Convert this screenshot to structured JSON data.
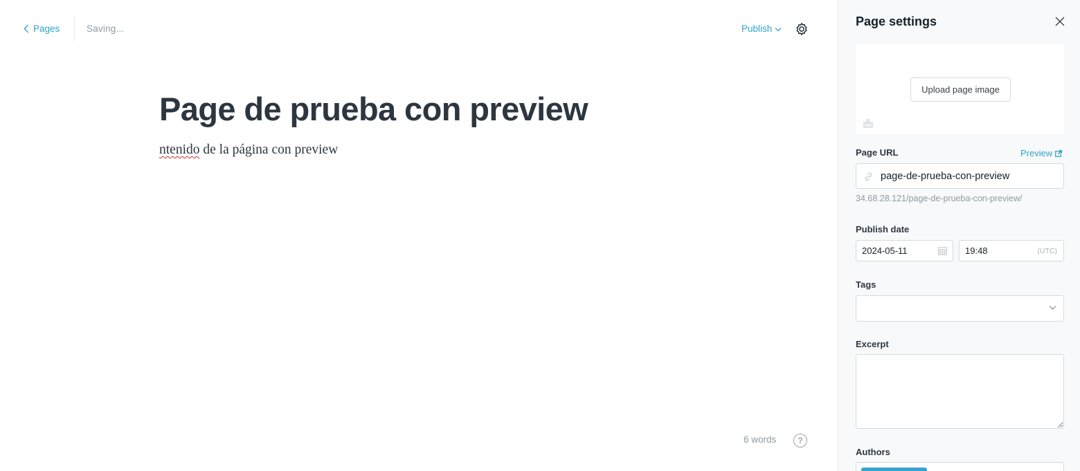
{
  "editor": {
    "back_label": "Pages",
    "status": "Saving...",
    "publish_label": "Publish",
    "title": "Page de prueba con preview",
    "body_misspelled": "ntenido",
    "body_rest": " de la página con preview",
    "word_count": "6 words",
    "help_glyph": "?"
  },
  "panel": {
    "title": "Page settings",
    "upload_label": "Upload page image",
    "url_label": "Page URL",
    "preview_label": "Preview",
    "url_value": "page-de-prueba-con-preview",
    "url_hint": "34.68.28.121/page-de-prueba-con-preview/",
    "publish_date_label": "Publish date",
    "date_value": "2024-05-11",
    "time_value": "19:48",
    "timezone": "(UTC)",
    "tags_label": "Tags",
    "excerpt_label": "Excerpt",
    "authors_label": "Authors"
  },
  "colors": {
    "accent": "#30a4c8",
    "panel_bg": "#f8f9fa",
    "title_text": "#2d3640",
    "muted_text": "#8e9aa3",
    "author_chip": "#35a3d0"
  },
  "icons": {
    "back": "chevron-left-icon",
    "publish_menu": "chevron-down-icon",
    "settings": "gear-icon",
    "close": "close-icon",
    "image_placeholder": "image-icon",
    "preview": "external-link-icon",
    "url": "link-icon",
    "date": "calendar-icon",
    "tags": "chevron-down-icon",
    "help": "question-mark-icon"
  }
}
